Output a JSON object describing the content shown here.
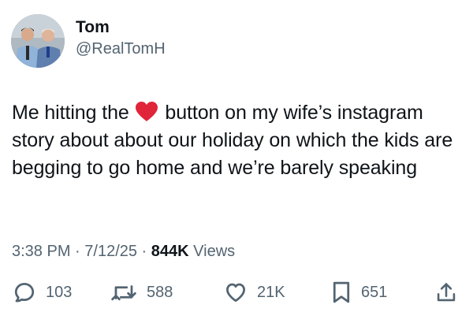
{
  "author": {
    "display_name": "Tom",
    "handle": "@RealTomH"
  },
  "tweet": {
    "text_before_emoji": "Me hitting the ",
    "emoji": "red-heart",
    "text_after_emoji": " button on my wife’s instagram story about about our holiday on which the kids are begging to go home and we’re barely speaking"
  },
  "meta": {
    "time": "3:38 PM",
    "separator_1": " · ",
    "date": "7/12/25",
    "separator_2": " · ",
    "views_count": "844K",
    "views_label": " Views"
  },
  "actions": {
    "replies": "103",
    "reposts": "588",
    "likes": "21K",
    "bookmarks": "651"
  },
  "colors": {
    "text_primary": "#0f1419",
    "text_secondary": "#536471",
    "heart": "#e0243a"
  },
  "icons": [
    "reply-icon",
    "repost-icon",
    "like-icon",
    "bookmark-icon",
    "share-icon"
  ]
}
